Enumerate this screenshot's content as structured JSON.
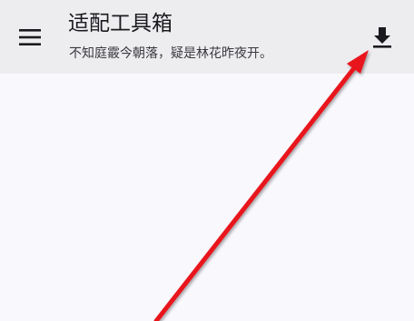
{
  "app_bar": {
    "title": "适配工具箱",
    "subtitle": "不知庭霰今朝落，疑是林花昨夜开。",
    "menu_icon": "menu-icon",
    "action_icon": "download-icon"
  },
  "colors": {
    "app_bar_bg": "#edecef",
    "content_bg": "#f9f8fd",
    "text_primary": "#1b1b1f",
    "annotation_arrow": "#e8141b"
  }
}
